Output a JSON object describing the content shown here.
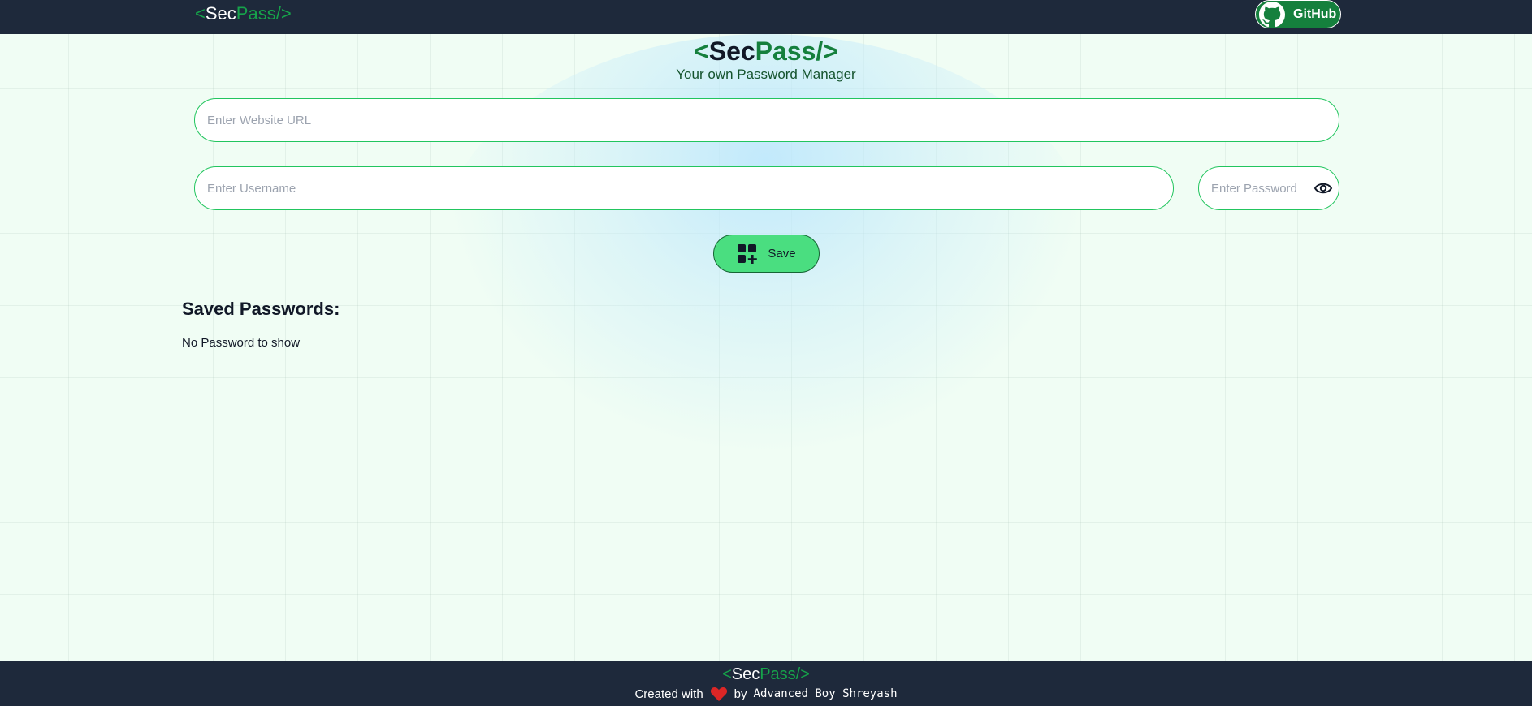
{
  "navbar": {
    "logo": {
      "open": "<",
      "sec": "Sec",
      "pass": "Pass/",
      "close": ">"
    },
    "github_label": "GitHub"
  },
  "hero": {
    "logo": {
      "open": "<",
      "sec": "Sec",
      "pass": "Pass/",
      "close": ">"
    },
    "tagline": "Your own Password Manager"
  },
  "form": {
    "url_placeholder": "Enter Website URL",
    "url_value": "",
    "username_placeholder": "Enter Username",
    "username_value": "",
    "password_placeholder": "Enter Password",
    "password_value": "",
    "save_label": "Save"
  },
  "saved": {
    "heading": "Saved Passwords:",
    "empty_message": "No Password to show"
  },
  "footer": {
    "logo": {
      "open": "<",
      "sec": "Sec",
      "pass": "Pass/",
      "close": ">"
    },
    "credit_prefix": "Created with",
    "credit_by": "by",
    "author": "Advanced_Boy_Shreyash"
  },
  "colors": {
    "navbar_bg": "#1e293b",
    "accent_green": "#16a34a",
    "button_green": "#4ade80",
    "page_bg": "#f0fdf4"
  },
  "icons": {
    "github": "github-icon",
    "eye": "eye-icon",
    "save": "add-grid-icon",
    "heart": "heart-icon"
  }
}
